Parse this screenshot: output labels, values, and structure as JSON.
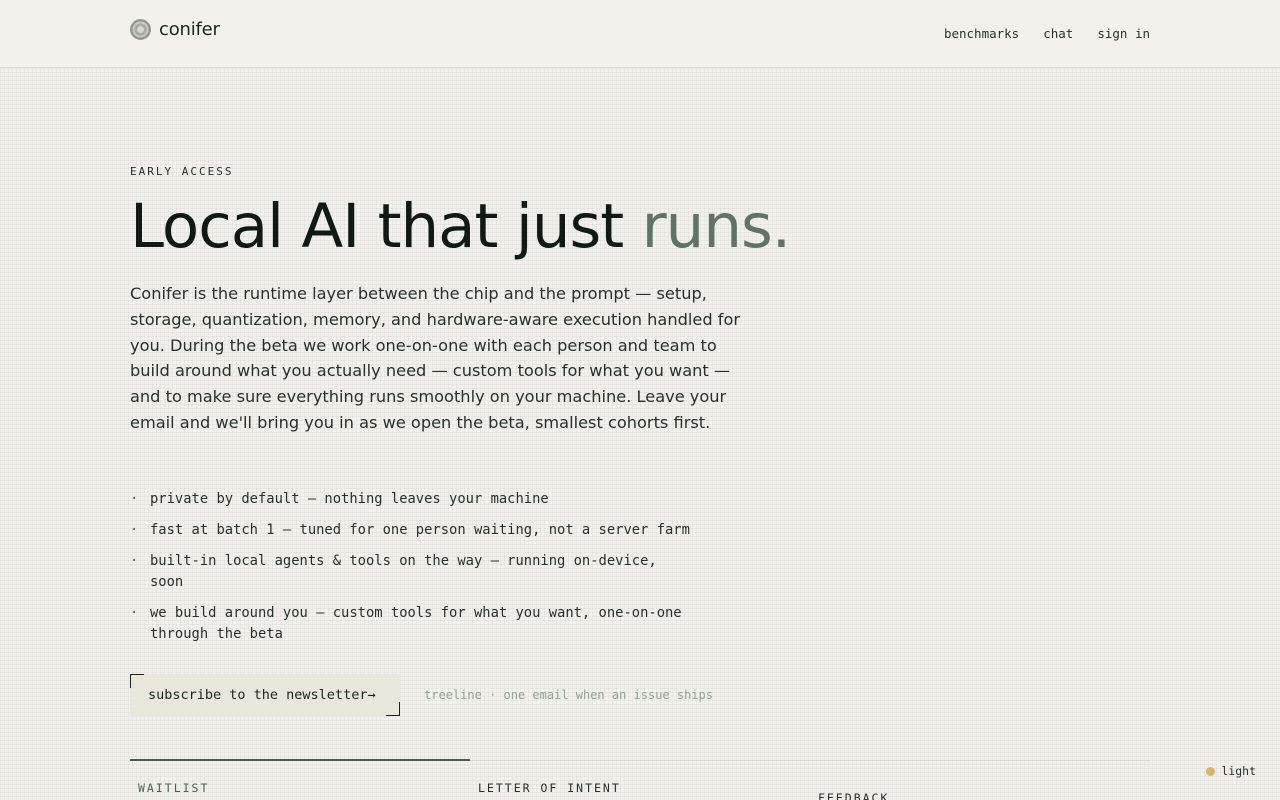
{
  "brand": {
    "name": "conifer",
    "logo_icon": "conifer-logo-icon"
  },
  "nav": {
    "benchmarks": "benchmarks",
    "chat": "chat",
    "sign_in": "sign in"
  },
  "hero": {
    "eyebrow": "EARLY ACCESS",
    "headline_main": "Local AI that just ",
    "headline_accent": "runs.",
    "lead": "Conifer is the runtime layer between the chip and the prompt — setup, storage, quantization, memory, and hardware-aware execution handled for you. During the beta we work one-on-one with each person and team to build around what you actually need — custom tools for what you want — and to make sure everything runs smoothly on your machine. Leave your email and we'll bring you in as we open the beta, smallest cohorts first."
  },
  "features": [
    {
      "bullet": "·",
      "text": "private by default — nothing leaves your machine"
    },
    {
      "bullet": "·",
      "text": "fast at batch 1 — tuned for one person waiting, not a server farm"
    },
    {
      "bullet": "·",
      "text": "built-in local agents & tools on the way — running on-device, soon"
    },
    {
      "bullet": "·",
      "text": "we build around you — custom tools for what you want, one-on-one through the beta"
    }
  ],
  "cta": {
    "label": "subscribe to the newsletter→",
    "note": "treeline · one email when an issue ships"
  },
  "tabs": {
    "waitlist": "WAITLIST",
    "letter": "LETTER OF INTENT",
    "feedback": "FEEDBACK"
  },
  "theme": {
    "label": "light",
    "dot_color": "#d9b46a"
  },
  "colors": {
    "accent": "#5f7366",
    "background": "#f2f1ec",
    "text": "#1d2620"
  }
}
